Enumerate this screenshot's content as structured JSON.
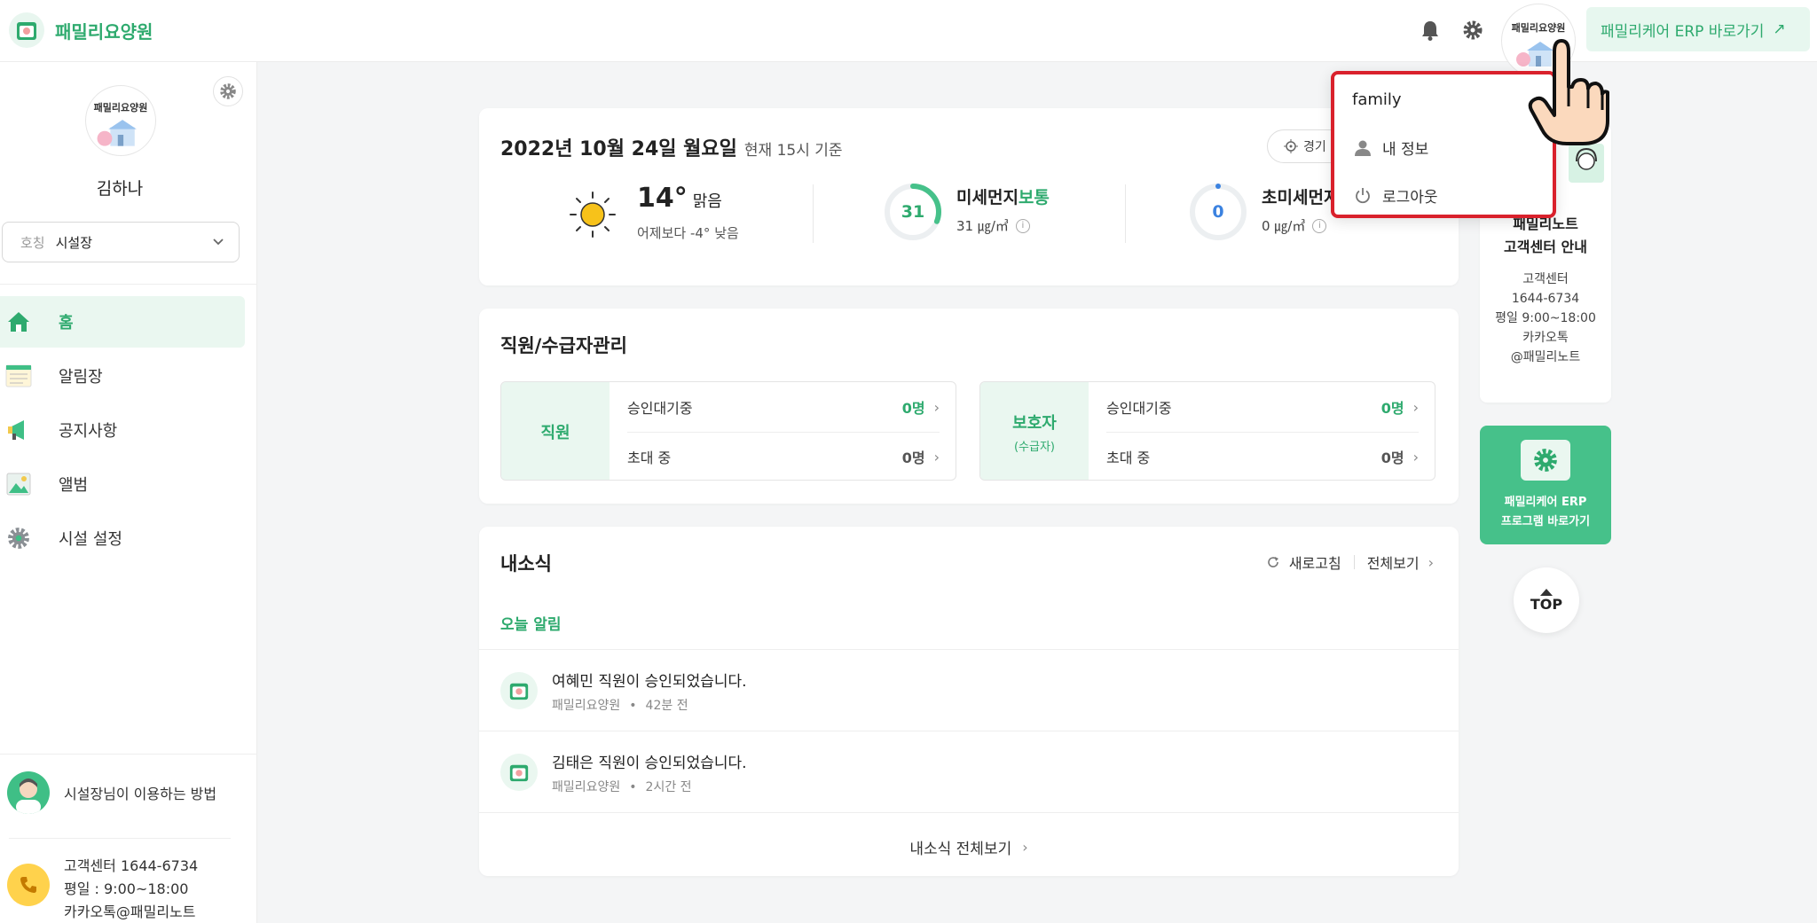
{
  "header": {
    "brand_name": "패밀리요양원",
    "avatar_label": "패밀리요양원",
    "erp_link": "패밀리케어 ERP 바로가기",
    "erp_arrow": "↗"
  },
  "sidebar": {
    "avatar_label": "패밀리요양원",
    "user_name": "김하나",
    "title_select": {
      "label": "호칭",
      "value": "시설장"
    },
    "nav": [
      {
        "label": "홈",
        "icon": "home-icon",
        "active": true
      },
      {
        "label": "알림장",
        "icon": "notebook-icon",
        "active": false
      },
      {
        "label": "공지사항",
        "icon": "megaphone-icon",
        "active": false
      },
      {
        "label": "앨범",
        "icon": "photo-icon",
        "active": false
      },
      {
        "label": "시설 설정",
        "icon": "gear-icon",
        "active": false
      }
    ],
    "howto": "시설장님이 이용하는 방법",
    "support": {
      "line1": "고객센터 1644-6734",
      "line2": "평일 : 9:00~18:00",
      "line3": "카카오톡@패밀리노트"
    }
  },
  "weather": {
    "date": "2022년 10월 24일 월요일",
    "basis": "현재 15시 기준",
    "location": "경기",
    "temp": "14°",
    "condition": "맑음",
    "comparison": "어제보다 -4° 낮음",
    "fine_dust": {
      "title": "미세먼지",
      "level": "보통",
      "value": "31",
      "unit_value": "31 ㎍/㎥",
      "fraction": 0.31
    },
    "ultra_dust": {
      "title": "초미세먼지",
      "value": "0",
      "unit_value": "0 ㎍/㎥",
      "fraction": 0.0
    }
  },
  "staff": {
    "title": "직원/수급자관리",
    "employee": {
      "label": "직원",
      "rows": [
        {
          "label": "승인대기중",
          "count": "0명"
        },
        {
          "label": "초대 중",
          "count": "0명"
        }
      ]
    },
    "guardian": {
      "label": "보호자",
      "sub": "(수급자)",
      "rows": [
        {
          "label": "승인대기중",
          "count": "0명"
        },
        {
          "label": "초대 중",
          "count": "0명"
        }
      ]
    }
  },
  "news": {
    "title": "내소식",
    "refresh": "새로고침",
    "view_all": "전체보기",
    "today_label": "오늘 알림",
    "items": [
      {
        "title": "여혜민 직원이 승인되었습니다.",
        "source": "패밀리요양원",
        "time": "42분 전"
      },
      {
        "title": "김태은 직원이 승인되었습니다.",
        "source": "패밀리요양원",
        "time": "2시간 전"
      }
    ],
    "all_link": "내소식 전체보기"
  },
  "right": {
    "cs_title_1": "패밀리노트",
    "cs_title_2": "고객센터 안내",
    "cs_lines": [
      "고객센터",
      "1644-6734",
      "평일 9:00~18:00",
      "카카오톡",
      "@패밀리노트"
    ],
    "erp_line1": "패밀리케어 ERP",
    "erp_line2": "프로그램 바로가기",
    "top": "TOP"
  },
  "dropdown": {
    "user": "family",
    "my_info": "내 정보",
    "logout": "로그아웃"
  },
  "colors": {
    "accent": "#2eaa6e",
    "highlight": "#d9212c"
  }
}
